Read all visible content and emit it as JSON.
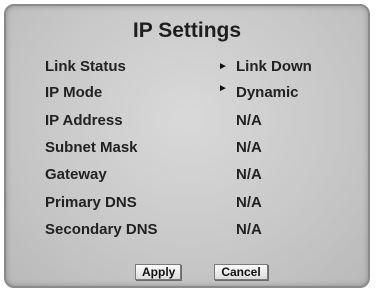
{
  "dialog": {
    "title": "IP Settings"
  },
  "rows": [
    {
      "label": "Link Status",
      "value": "Link Down",
      "has_arrow": true
    },
    {
      "label": "IP Mode",
      "value": "Dynamic",
      "has_arrow": true
    },
    {
      "label": "IP Address",
      "value": "N/A",
      "has_arrow": false
    },
    {
      "label": "Subnet Mask",
      "value": "N/A",
      "has_arrow": false
    },
    {
      "label": "Gateway",
      "value": "N/A",
      "has_arrow": false
    },
    {
      "label": "Primary DNS",
      "value": "N/A",
      "has_arrow": false
    },
    {
      "label": "Secondary DNS",
      "value": "N/A",
      "has_arrow": false
    }
  ],
  "arrow_icon": "triangle-right-icon",
  "buttons": {
    "apply_label": "Apply",
    "cancel_label": "Cancel"
  }
}
